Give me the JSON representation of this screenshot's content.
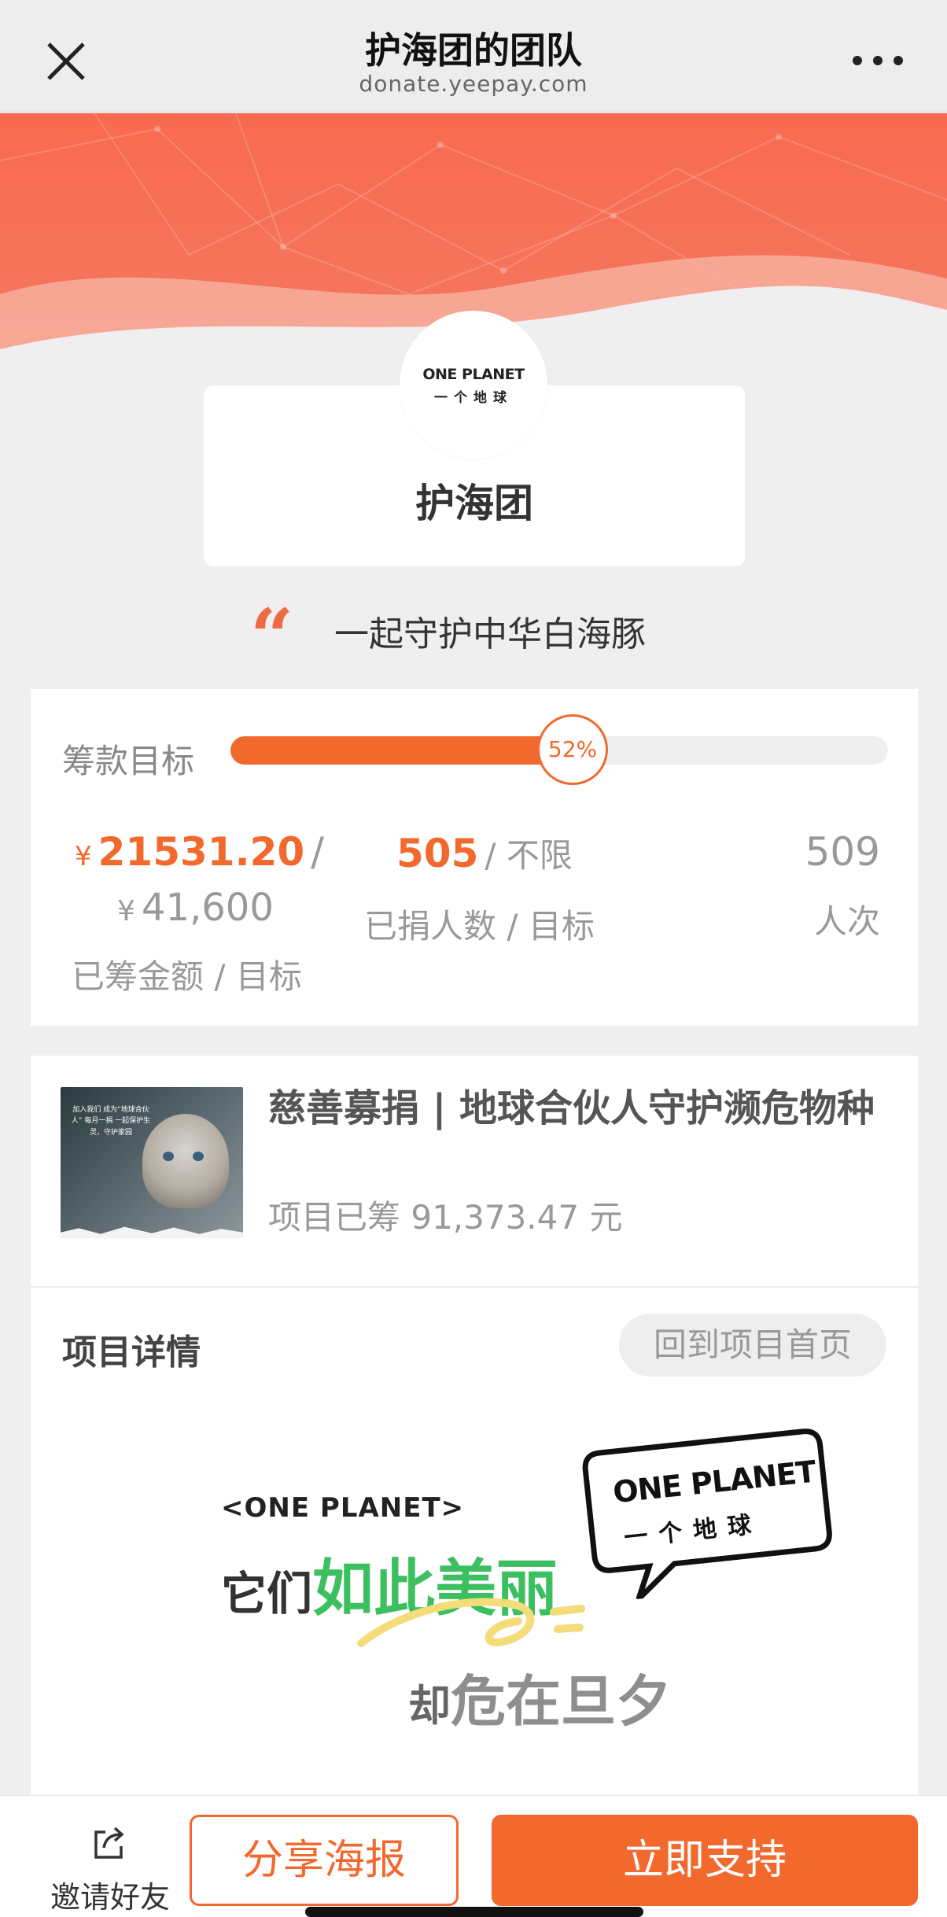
{
  "nav": {
    "title": "护海团的团队",
    "subtitle": "donate.yeepay.com",
    "close_icon": "close-icon",
    "more_icon": "more-dots-icon"
  },
  "team": {
    "logo_text": "ONE PLANET",
    "logo_sub": "一个地球",
    "name": "护海团",
    "slogan": "一起守护中华白海豚"
  },
  "progress": {
    "goal_label": "筹款目标",
    "percent": 0.52,
    "percent_label": "52%",
    "amount_currency": "¥",
    "amount_raised": "21531.20",
    "amount_sep": "/",
    "target_currency": "¥",
    "amount_target": "41,600",
    "amount_label": "已筹金额 / 目标",
    "donors": "505",
    "donors_target": "/ 不限",
    "donors_label": "已捐人数 / 目标",
    "times": "509",
    "times_label": "人次"
  },
  "project": {
    "title": "慈善募捐 | 地球合伙人守护濒危物种",
    "raised": "项目已筹 91,373.47 元",
    "thumb_text": "加入我们 成为“地球合伙人” 每月一捐 一起保护生灵，守护家园"
  },
  "details": {
    "title": "项目详情",
    "back_button": "回到项目首页",
    "banner_one": "<ONE PLANET>",
    "banner_prefix": "它们",
    "banner_highlight": "如此美丽",
    "banner_prefix2": "却",
    "banner_line2": "危在旦夕",
    "bubble_logo": "ONE PLANET",
    "bubble_sub": "一个地球"
  },
  "bottom": {
    "invite_label": "邀请好友",
    "share_label": "分享海报",
    "support_label": "立即支持"
  },
  "colors": {
    "accent": "#f2692e",
    "hero": "#f7684f",
    "green": "#3bbf5f"
  }
}
